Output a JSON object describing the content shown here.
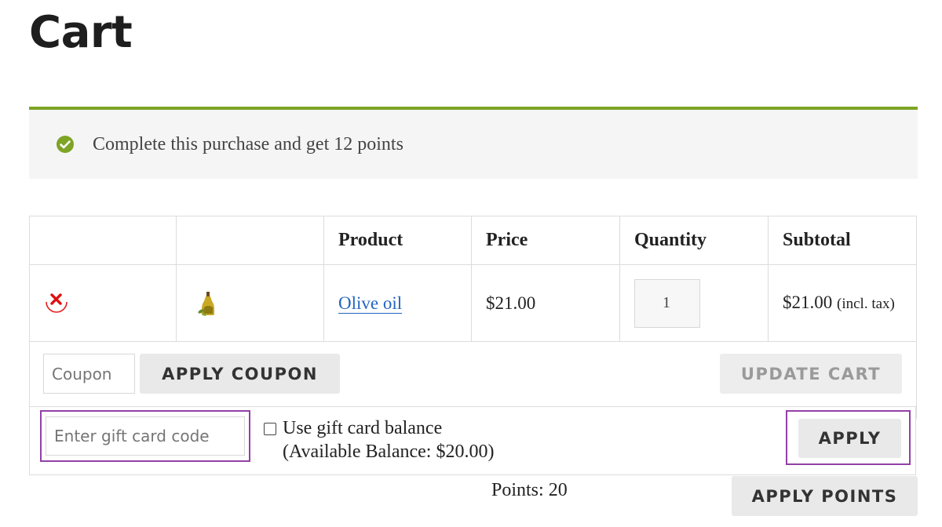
{
  "page": {
    "title": "Cart"
  },
  "notice": {
    "icon": "check-circle-icon",
    "text": "Complete this purchase and get 12 points",
    "accent_color": "#7ea425"
  },
  "cart_table": {
    "headers": [
      "",
      "",
      "Product",
      "Price",
      "Quantity",
      "Subtotal"
    ],
    "rows": [
      {
        "remove_icon": "remove-x-icon",
        "thumbnail_icon": "olive-oil-bottle-icon",
        "product": "Olive oil",
        "price": "$21.00",
        "quantity": "1",
        "subtotal": "$21.00",
        "subtotal_tax_note": "(incl. tax)"
      }
    ]
  },
  "actions": {
    "coupon_placeholder": "Coupon",
    "apply_coupon_label": "APPLY COUPON",
    "update_cart_label": "UPDATE CART"
  },
  "gift_card": {
    "placeholder": "Enter gift card code",
    "use_balance_label": "Use gift card balance",
    "available_balance": "(Available Balance: $20.00)",
    "use_balance_checked": false,
    "apply_label": "APPLY",
    "highlight_color": "#9340a6"
  },
  "points": {
    "text": "Points: 20",
    "apply_label": "APPLY POINTS"
  }
}
